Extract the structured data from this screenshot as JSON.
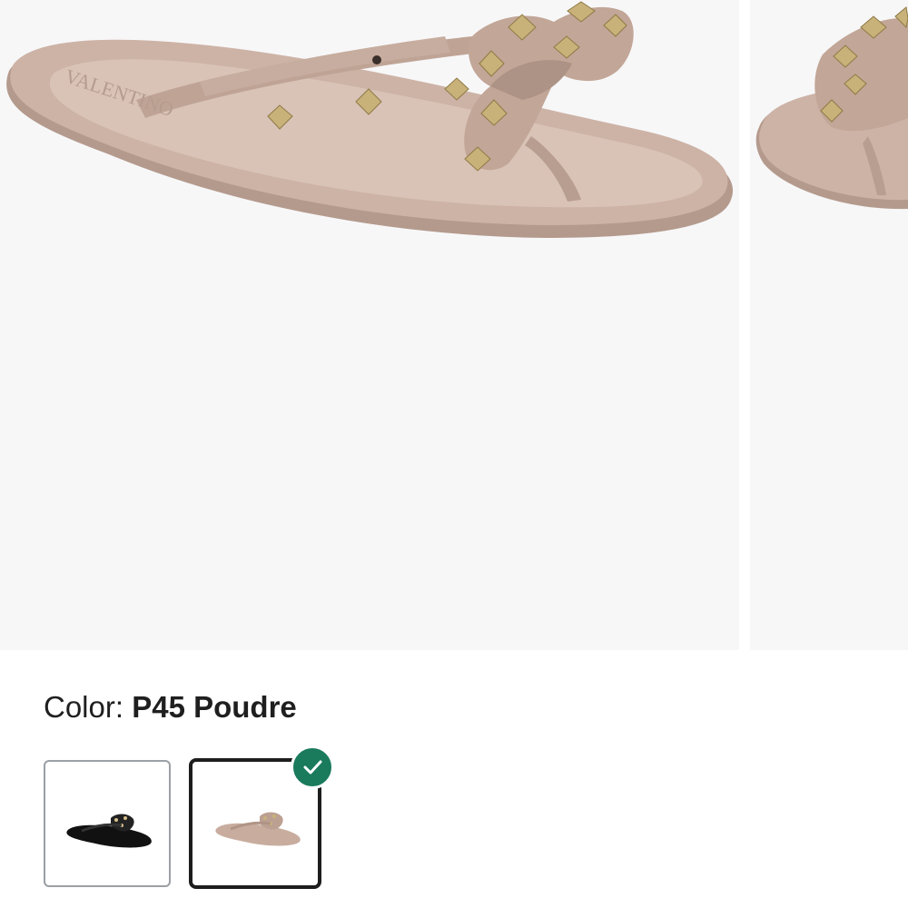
{
  "gallery": {
    "main_image_alt": "Valentino Rockstud jelly thong sandal in Poudre",
    "brand_imprint": "VALENTINO",
    "colors": {
      "background": "#f7f7f8",
      "sandal": "#c8ad9f",
      "sandal_shadow": "#b0968a",
      "stud": "#c9b27a"
    }
  },
  "color_selector": {
    "label": "Color:",
    "selected_value": "P45 Poudre",
    "options": [
      {
        "name": "Black",
        "selected": false,
        "thumb_color": "#1a1a1a"
      },
      {
        "name": "P45 Poudre",
        "selected": true,
        "thumb_color": "#c8ad9f"
      }
    ],
    "selected_badge_icon": "check-icon",
    "accent_color": "#1a7a5c"
  }
}
